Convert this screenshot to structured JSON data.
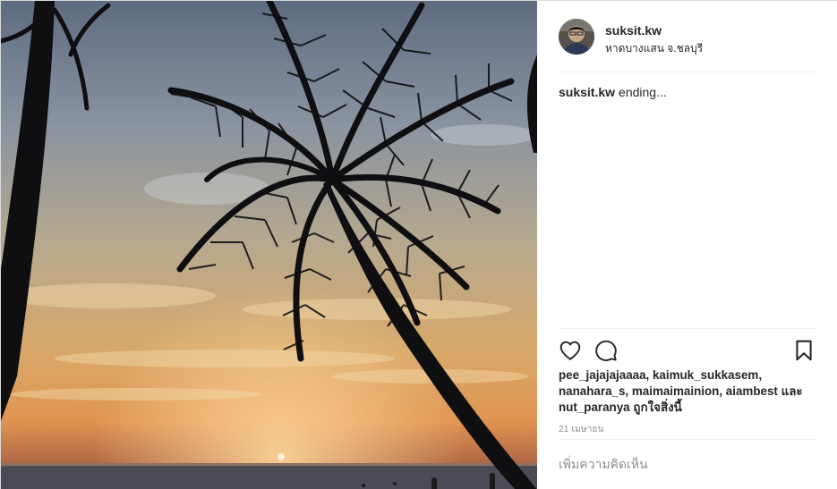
{
  "post": {
    "username": "suksit.kw",
    "location": "หาดบางแสน จ.ชลบุรี",
    "caption_user": "suksit.kw",
    "caption_text": "ending...",
    "likes_text": "pee_jajajajaaaa, kaimuk_sukkasem, nanahara_s, maimaimainion, aiambest และ nut_paranya",
    "likes_suffix": "ถูกใจสิ่งนี้",
    "timestamp": "21 เมษายน",
    "comment_placeholder": "เพิ่มความคิดเห็น"
  },
  "icons": {
    "like": "heart-icon",
    "comment": "comment-bubble-icon",
    "save": "bookmark-icon"
  },
  "colors": {
    "text": "#262626",
    "muted": "#8e8e8e",
    "divider": "#efefef"
  }
}
